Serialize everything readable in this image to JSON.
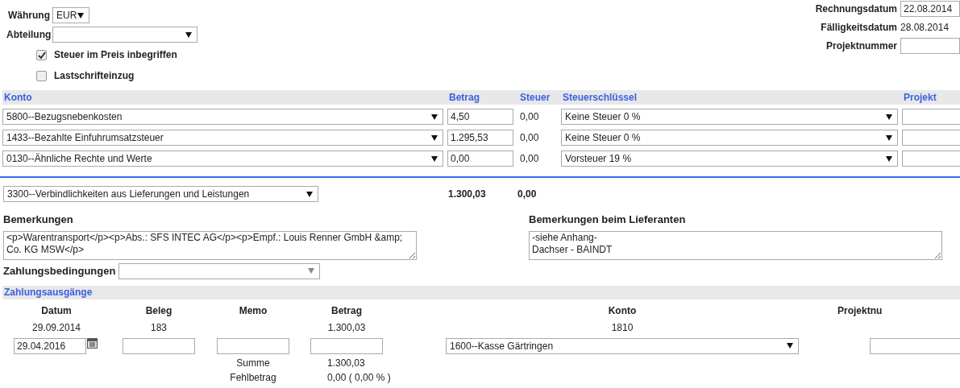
{
  "header_left": {
    "currency": {
      "label": "Währung",
      "value": "EUR"
    },
    "department": {
      "label": "Abteilung"
    },
    "checkboxes": [
      {
        "label": "Steuer im Preis inbegriffen",
        "checked": true
      },
      {
        "label": "Lastschrifteinzug",
        "checked": false
      }
    ]
  },
  "header_right": [
    {
      "label": "Rechnungsdatum",
      "value": "22.08.2014",
      "kind": "input"
    },
    {
      "label": "Fälligkeitsdatum",
      "value": "28.08.2014",
      "kind": "text"
    },
    {
      "label": "Projektnummer",
      "kind": "input"
    }
  ],
  "booking_table": {
    "columns": [
      "Konto",
      "Betrag",
      "Steuer",
      "Steuerschlüssel",
      "Projekt"
    ],
    "rows": [
      {
        "konto": "5800--Bezugsnebenkosten",
        "betrag": "4,50",
        "steuer": "0,00",
        "steuerschluessel": "Keine Steuer 0 %"
      },
      {
        "konto": "1433--Bezahlte Einfuhrumsatzsteuer",
        "betrag": "1.295,53",
        "steuer": "0,00",
        "steuerschluessel": "Keine Steuer 0 %"
      },
      {
        "konto": "0130--Ähnliche Rechte und Werte",
        "betrag": "0,00",
        "steuer": "0,00",
        "steuerschluessel": "Vorsteuer 19 %"
      }
    ]
  },
  "total": {
    "account": "3300--Verbindlichkeiten aus Lieferungen und Leistungen",
    "amount": "1.300,03",
    "tax": "0,00"
  },
  "remarks": {
    "label": "Bemerkungen",
    "value": "<p>Warentransport</p><p>Abs.: SFS INTEC AG</p><p>Empf.: Louis Renner GmbH &amp; Co. KG MSW</p>"
  },
  "supplier_remarks": {
    "label": "Bemerkungen beim Lieferanten",
    "value": "-siehe Anhang-\nDachser - BAINDT"
  },
  "payment_terms": {
    "label": "Zahlungsbedingungen"
  },
  "payments": {
    "title": "Zahlungsausgänge",
    "columns": [
      "Datum",
      "Beleg",
      "Memo",
      "Betrag",
      "Konto",
      "Projektnu"
    ],
    "rows": [
      {
        "datum": "29.09.2014",
        "beleg": "183",
        "betrag": "1.300,03",
        "konto": "1810"
      }
    ],
    "new_payment": {
      "date": "29.04.2016",
      "account": "1600--Kasse Gärtringen"
    },
    "summary": [
      {
        "label": "Summe",
        "value": "1.300,03"
      },
      {
        "label": "Fehlbetrag",
        "value": "0,00 ( 0,00 % )"
      }
    ]
  }
}
